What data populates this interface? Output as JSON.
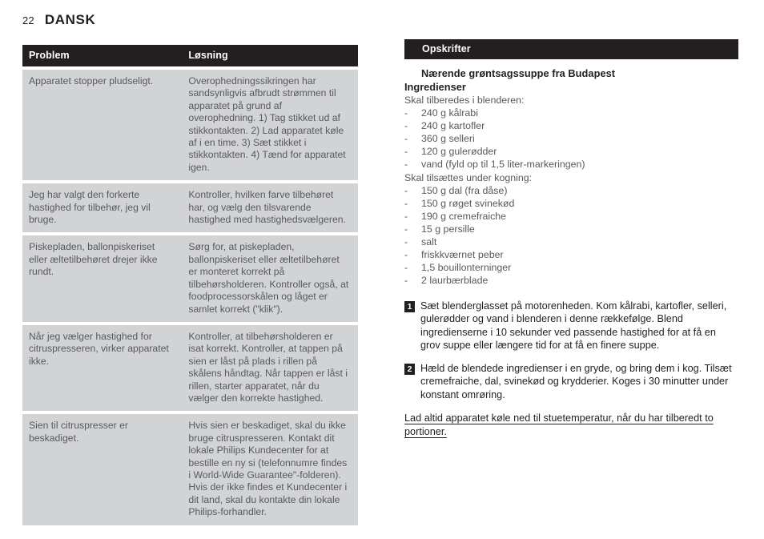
{
  "header": {
    "page_number": "22",
    "language": "DANSK"
  },
  "troubleshooting_table": {
    "columns": [
      "Problem",
      "Løsning"
    ],
    "rows": [
      {
        "problem": "Apparatet stopper pludseligt.",
        "solution": "Overophedningssikringen har sandsynligvis afbrudt strømmen til apparatet på grund af overophedning. 1) Tag stikket ud af stikkontakten. 2) Lad apparatet køle af i en time. 3) Sæt stikket i stikkontakten. 4) Tænd for apparatet igen."
      },
      {
        "problem": "Jeg har valgt den forkerte hastighed for tilbehør, jeg vil bruge.",
        "solution": "Kontroller, hvilken farve tilbehøret har, og vælg den tilsvarende hastighed med hastighedsvælgeren."
      },
      {
        "problem": "Piskepladen, ballonpiskeriset eller æltetilbehøret drejer ikke rundt.",
        "solution": "Sørg for, at piskepladen, ballonpiskeriset eller æltetilbehøret er monteret korrekt på tilbehørsholderen. Kontroller også, at foodprocessorskålen og låget er samlet korrekt (\"klik\")."
      },
      {
        "problem": "Når jeg vælger hastighed for citruspresseren, virker apparatet ikke.",
        "solution": "Kontroller, at tilbehørsholderen er isat korrekt. Kontroller, at tappen på sien er låst på plads i rillen på skålens håndtag. Når tappen er låst i rillen, starter apparatet, når du vælger den korrekte hastighed."
      },
      {
        "problem": "Sien til citruspresser er beskadiget.",
        "solution": "Hvis sien er beskadiget, skal du ikke bruge citruspresseren. Kontakt dit lokale Philips Kundecenter for at bestille en ny si (telefonnumre findes i World-Wide Guarantee\"-folderen). Hvis der ikke findes et Kundecenter i dit land, skal du kontakte din lokale Philips-forhandler."
      }
    ]
  },
  "recipes": {
    "section_title": "Opskrifter",
    "recipe_title": "Nærende grøntsagssuppe fra Budapest",
    "ingredients_heading": "Ingredienser",
    "groups": [
      {
        "label": "Skal tilberedes i blenderen:",
        "items": [
          "240 g kålrabi",
          "240 g kartofler",
          "360 g selleri",
          "120 g gulerødder",
          "vand (fyld op til 1,5 liter-markeringen)"
        ]
      },
      {
        "label": "Skal tilsættes under kogning:",
        "items": [
          "150 g dal (fra dåse)",
          "150 g røget svinekød",
          "190 g cremefraiche",
          "15 g persille",
          "salt",
          "friskkværnet peber",
          "1,5 bouillonterninger",
          "2 laurbærblade"
        ]
      }
    ],
    "bullet_dash": "-",
    "steps": [
      {
        "number": "1",
        "text": "Sæt blenderglasset på motorenheden. Kom kålrabi, kartofler, selleri, gulerødder og vand i blenderen i denne rækkefølge. Blend ingredienserne i 10 sekunder ved passende hastighed for at få en grov suppe eller længere tid for at få en finere suppe."
      },
      {
        "number": "2",
        "text": "Hæld de blendede ingredienser i en gryde, og bring dem i kog. Tilsæt cremefraiche, dal, svinekød og krydderier. Koges i 30 minutter under konstant omrøring."
      }
    ],
    "footnote": "Lad altid apparatet køle ned til stuetemperatur, når du har tilberedt to portioner."
  },
  "colors": {
    "ink": "#231f20",
    "table_row_bg": "#d2d3d5",
    "body_text": "#58595b"
  }
}
